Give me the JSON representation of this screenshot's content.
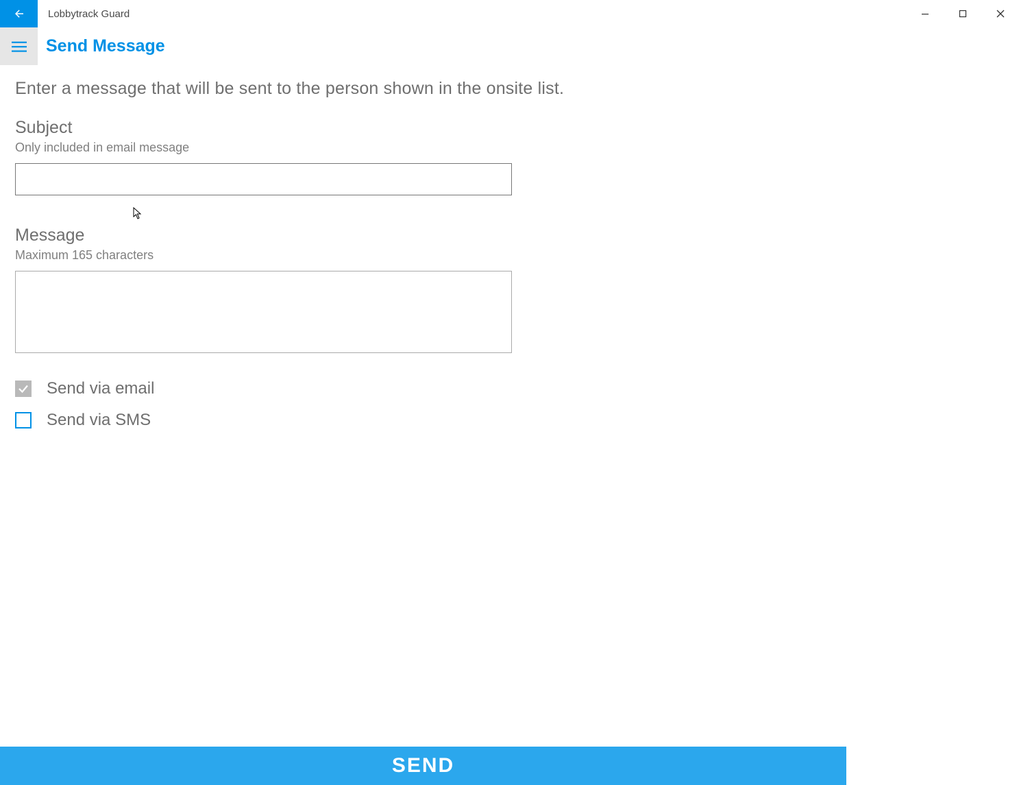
{
  "window": {
    "title": "Lobbytrack Guard"
  },
  "page": {
    "title": "Send Message",
    "instruction": "Enter a message that will be sent to the person shown in the onsite list."
  },
  "subject": {
    "label": "Subject",
    "hint": "Only included in email message",
    "value": ""
  },
  "message": {
    "label": "Message",
    "hint": "Maximum 165 characters",
    "value": ""
  },
  "options": {
    "email_label": "Send via email",
    "email_checked": true,
    "sms_label": "Send via SMS",
    "sms_checked": false
  },
  "actions": {
    "send_label": "SEND"
  }
}
